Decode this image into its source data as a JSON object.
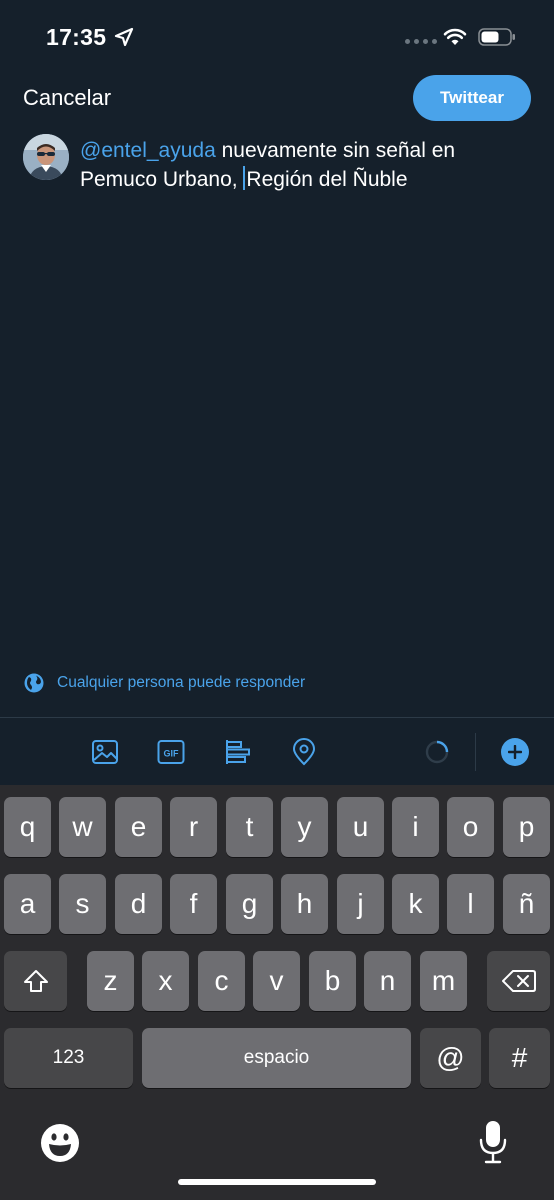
{
  "status_bar": {
    "time": "17:35"
  },
  "header": {
    "cancel_label": "Cancelar",
    "tweet_label": "Twittear"
  },
  "compose": {
    "mention": "@entel_ayuda",
    "text_before_caret": " nuevamente sin señal en Pemuco Urbano, ",
    "text_after_caret": "Región del Ñuble"
  },
  "reply_setting": {
    "label": "Cualquier persona puede responder"
  },
  "toolbar": {
    "icons": [
      "audio-waveform-icon",
      "image-icon",
      "gif-icon",
      "poll-icon",
      "location-pin-icon",
      "progress-ring",
      "add-tweet-icon"
    ]
  },
  "keyboard": {
    "row1": [
      "q",
      "w",
      "e",
      "r",
      "t",
      "y",
      "u",
      "i",
      "o",
      "p"
    ],
    "row2": [
      "a",
      "s",
      "d",
      "f",
      "g",
      "h",
      "j",
      "k",
      "l",
      "ñ"
    ],
    "row3": [
      "z",
      "x",
      "c",
      "v",
      "b",
      "n",
      "m"
    ],
    "numbers_label": "123",
    "space_label": "espacio",
    "at_label": "@",
    "hash_label": "#"
  },
  "colors": {
    "background": "#15202b",
    "accent": "#4aa3ea",
    "keyboard_bg": "#2b2b2e",
    "key": "#6e6e72"
  }
}
